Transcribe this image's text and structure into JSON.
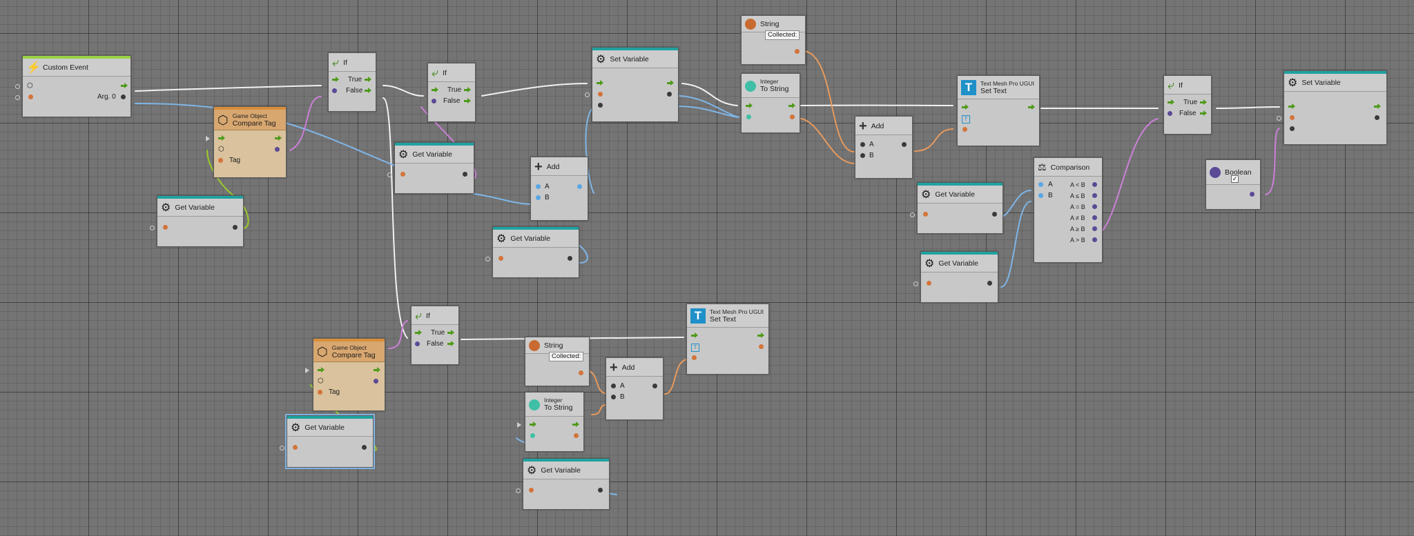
{
  "colors": {
    "canvas": "#747474",
    "flow_wire": "#f2f2f2",
    "float_wire": "#7fb6e8",
    "bool_wire": "#cc80d8",
    "string_wire": "#e89a5c",
    "gameobject_wire": "#9ccb2a"
  },
  "nodes": {
    "custom_event": {
      "title": "Custom Event",
      "arg0": "Arg. 0"
    },
    "compare_tag_1": {
      "sub": "Game Object",
      "title": "Compare Tag",
      "tag": "Tag"
    },
    "compare_tag_2": {
      "sub": "Game Object",
      "title": "Compare Tag",
      "tag": "Tag"
    },
    "if_1": {
      "title": "If",
      "true": "True",
      "false": "False"
    },
    "if_2": {
      "title": "If",
      "true": "True",
      "false": "False"
    },
    "if_3": {
      "title": "If",
      "true": "True",
      "false": "False"
    },
    "if_4": {
      "title": "If",
      "true": "True",
      "false": "False"
    },
    "get_variable": "Get Variable",
    "set_variable": "Set Variable",
    "add": {
      "title": "Add",
      "a": "A",
      "b": "B"
    },
    "string_1": {
      "title": "String",
      "value": "Collected:"
    },
    "string_2": {
      "title": "String",
      "value": "Collected:"
    },
    "integer_to_string": {
      "sub": "Integer",
      "title": "To String"
    },
    "set_text": {
      "sub": "Text Mesh Pro UGUI",
      "title": "Set Text"
    },
    "comparison": {
      "title": "Comparison",
      "a": "A",
      "b": "B",
      "outputs": [
        "A < B",
        "A ≤ B",
        "A = B",
        "A ≠ B",
        "A ≥ B",
        "A > B"
      ]
    },
    "boolean": {
      "title": "Boolean",
      "value": "✓"
    }
  }
}
